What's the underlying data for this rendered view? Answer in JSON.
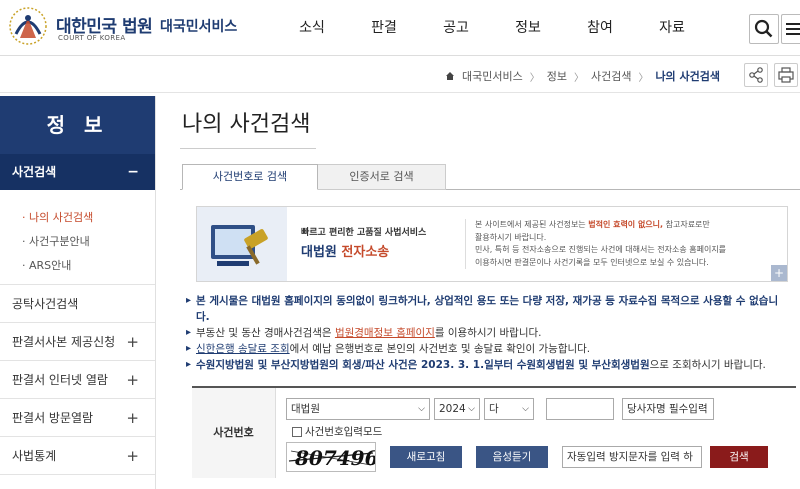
{
  "header": {
    "brand_main": "대한민국 법원",
    "brand_sub": "COURT OF KOREA",
    "service": "대국민서비스",
    "nav": [
      "소식",
      "판결",
      "공고",
      "정보",
      "참여",
      "자료"
    ]
  },
  "breadcrumb": {
    "home": "대국민서비스",
    "level1": "정보",
    "level2": "사건검색",
    "current": "나의 사건검색"
  },
  "sidebar": {
    "title": "정 보",
    "active_section": "사건검색",
    "sub_items": [
      "나의 사건검색",
      "사건구분안내",
      "ARS안내"
    ],
    "items": [
      {
        "label": "공탁사건검색",
        "expandable": false
      },
      {
        "label": "판결서사본 제공신청",
        "expandable": true
      },
      {
        "label": "판결서 인터넷 열람",
        "expandable": true
      },
      {
        "label": "판결서 방문열람",
        "expandable": true
      },
      {
        "label": "사법통계",
        "expandable": true
      }
    ]
  },
  "main": {
    "title": "나의 사건검색",
    "tabs": [
      "사건번호로 검색",
      "인증서로 검색"
    ]
  },
  "banner": {
    "line1": "빠르고 편리한 고품질 사법서비스",
    "line2_prefix": "대법원 ",
    "line2_highlight": "전자소송",
    "desc1_a": "본 사이트에서 제공된 사건정보는 ",
    "desc1_em": "법적인 효력이 없으니,",
    "desc1_b": " 참고자료로만",
    "desc2": "활용하시기 바랍니다.",
    "desc3": "민사, 특허 등 전자소송으로 진행되는 사건에 대해서는 전자소송 홈페이지를",
    "desc4": "이용하시면 판결문이나 사건기록을 모두 인터넷으로 보실 수 있습니다."
  },
  "notices": {
    "n1": "본 게시물은 대법원 홈페이지의 동의없이 링크하거나, 상업적인 용도 또는 다량 저장, 재가공 등 자료수집 목적으로 사용할 수 없습니",
    "n1_cont": "다.",
    "n2_a": "부동산 및 동산 경매사건검색은 ",
    "n2_link": "법원경매정보 홈페이지",
    "n2_b": "를 이용하시기 바랍니다.",
    "n3_link": "신한은행 송달료 조회",
    "n3_b": "에서 예납 은행번호로 본인의 사건번호 및 송달료 확인이 가능합니다.",
    "n4_strong": "수원지방법원 및 부산지방법원의 회생/파산 사건은 2023. 3. 1.일부터 수원회생법원 및 부산회생법원",
    "n4_b": "으로 조회하시기 바랍니다."
  },
  "form": {
    "label": "사건번호",
    "court_value": "대법원",
    "year_value": "2024",
    "type_value": "다",
    "party_value": "당사자명 필수입력",
    "checkbox_label": "사건번호입력모드",
    "captcha_text": "807496",
    "refresh_label": "새로고침",
    "audio_label": "음성듣기",
    "captcha_placeholder": "자동입력 방지문자를 입력 하",
    "search_label": "검색"
  }
}
